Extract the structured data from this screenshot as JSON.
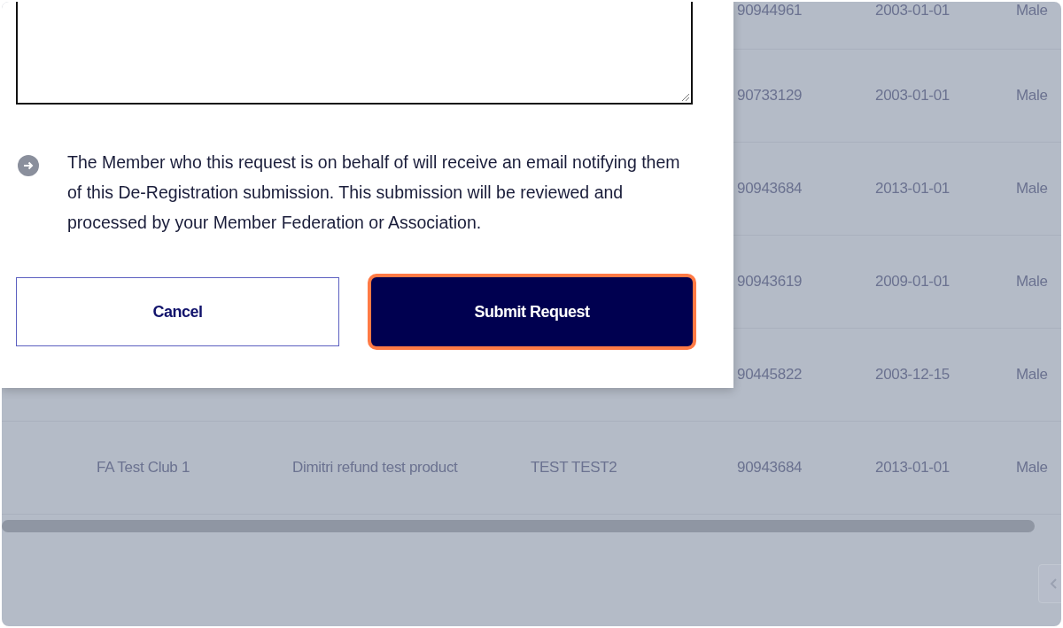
{
  "table": {
    "rows": [
      {
        "column_4": "90944961",
        "column_5": "2003-01-01",
        "column_6": "Male"
      },
      {
        "column_4": "90733129",
        "column_5": "2003-01-01",
        "column_6": "Male"
      },
      {
        "column_4": "90943684",
        "column_5": "2013-01-01",
        "column_6": "Male"
      },
      {
        "column_4": "90943619",
        "column_5": "2009-01-01",
        "column_6": "Male"
      },
      {
        "column_4": "90445822",
        "column_5": "2003-12-15",
        "column_6": "Male"
      },
      {
        "column_1": "FA Test Club 1",
        "column_2": "Dimitri refund test product",
        "column_3": "TEST TEST2",
        "column_4": "90943684",
        "column_5": "2013-01-01",
        "column_6": "Male"
      }
    ]
  },
  "dialog": {
    "notice": "The Member who this request is on behalf of will receive an email notifying them of this De-Registration submission. This submission will be reviewed and processed by your Member Federation or Association.",
    "buttons": [
      {
        "label": "Cancel",
        "kind": "secondary",
        "highlighted": false
      },
      {
        "label": "Submit Request",
        "kind": "primary",
        "highlighted": true
      }
    ]
  }
}
